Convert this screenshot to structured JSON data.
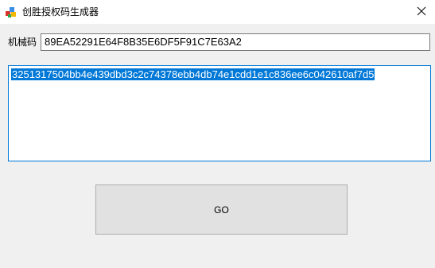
{
  "window": {
    "title": "创胜授权码生成器"
  },
  "form": {
    "machine_code_label": "机械码",
    "machine_code_value": "89EA52291E64F8B35E6DF5F91C7E63A2",
    "auth_code_value": "3251317504bb4e439dbd3c2c74378ebb4db74e1cdd1e1c836ee6c042610af7d5"
  },
  "actions": {
    "go_label": "GO"
  },
  "colors": {
    "selection": "#0078d7",
    "focus_border": "#0078d7",
    "button_bg": "#e1e1e1",
    "window_bg": "#f0f0f0"
  },
  "icons": {
    "app": "app-icon",
    "close": "close-icon"
  }
}
